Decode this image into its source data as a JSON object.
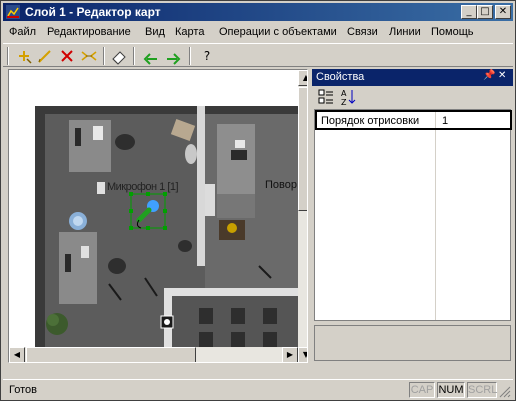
{
  "window": {
    "title": "Слой 1 - Редактор карт"
  },
  "menu": [
    "Файл",
    "Редактирование",
    "Вид",
    "Карта",
    "Операции с объектами",
    "Связи",
    "Линии",
    "Помощь"
  ],
  "toolbar": {
    "tools": [
      "add-icon",
      "pencil-icon",
      "delete-icon",
      "link-icon",
      "eraser-icon",
      "undo-icon",
      "redo-icon",
      "help-icon"
    ],
    "help_label": "?"
  },
  "map": {
    "labels": {
      "overlap": "Микрофон 1 [1]",
      "right": "Повор"
    }
  },
  "properties": {
    "title": "Свойства",
    "rows": [
      {
        "name": "Порядок отрисовки",
        "value": "1"
      }
    ]
  },
  "status": {
    "text": "Готов",
    "indicators": [
      {
        "label": "CAP",
        "active": false
      },
      {
        "label": "NUM",
        "active": true
      },
      {
        "label": "SCRL",
        "active": false
      }
    ]
  },
  "colors": {
    "title_active": "#0a246a",
    "window_face": "#d4d0c8",
    "selection": "#00a000"
  }
}
